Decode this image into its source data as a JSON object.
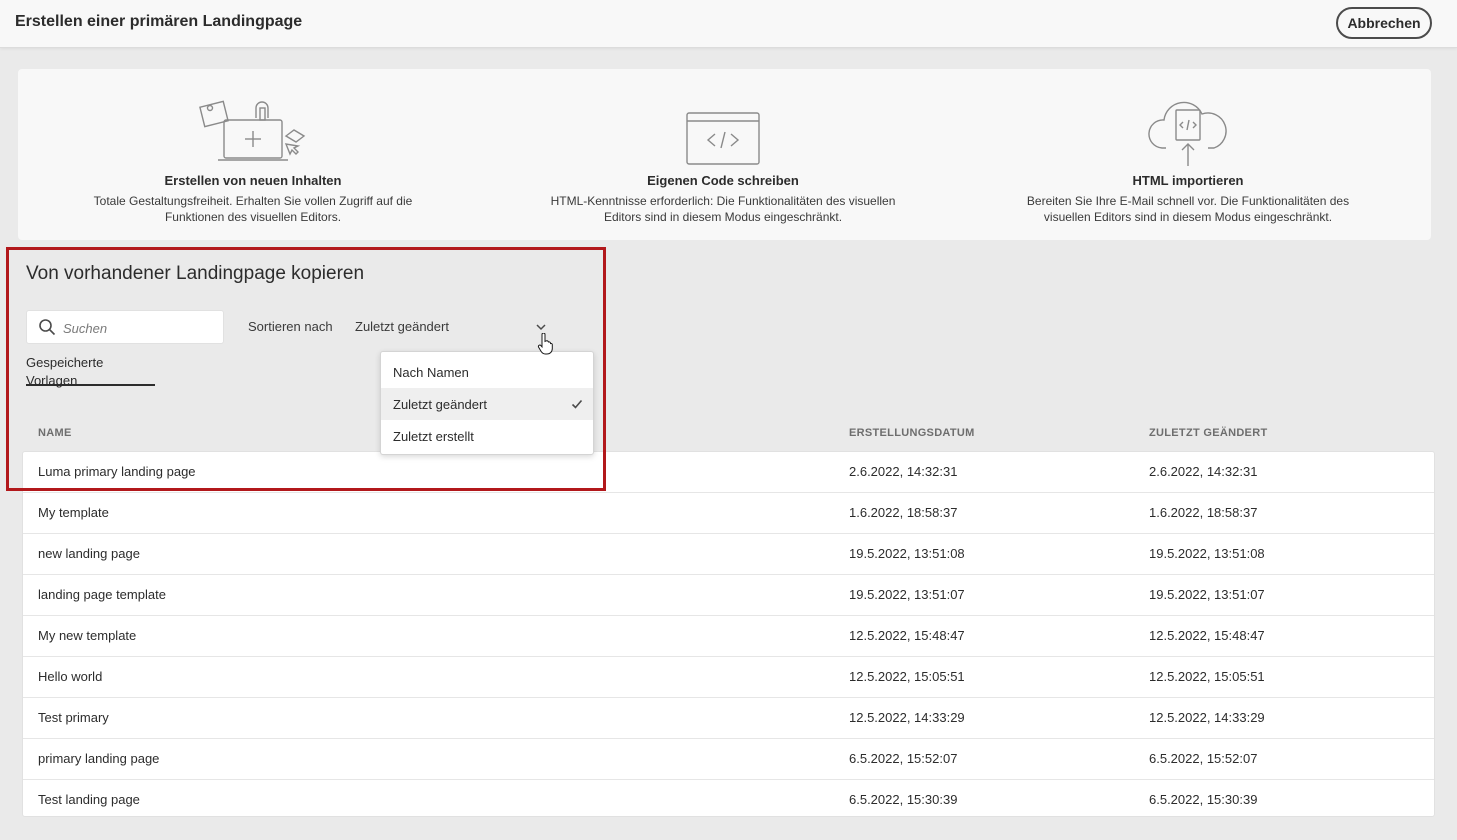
{
  "header": {
    "title": "Erstellen einer primären Landingpage",
    "cancel_label": "Abbrechen"
  },
  "options": [
    {
      "title": "Erstellen von neuen Inhalten",
      "description": "Totale Gestaltungsfreiheit. Erhalten Sie vollen Zugriff auf die Funktionen des visuellen Editors.",
      "icon": "design-canvas-icon"
    },
    {
      "title": "Eigenen Code schreiben",
      "description": "HTML-Kenntnisse erforderlich: Die Funktionalitäten des visuellen Editors sind in diesem Modus eingeschränkt.",
      "icon": "code-window-icon"
    },
    {
      "title": "HTML importieren",
      "description": "Bereiten Sie Ihre E-Mail schnell vor. Die Funktionalitäten des visuellen Editors sind in diesem Modus eingeschränkt.",
      "icon": "cloud-upload-icon"
    }
  ],
  "copy_section": {
    "title": "Von vorhandener Landingpage kopieren",
    "search_placeholder": "Suchen",
    "sort_label": "Sortieren nach",
    "sort_value": "Zuletzt geändert",
    "tab_label": "Gespeicherte Vorlagen"
  },
  "sort_dropdown": {
    "items": [
      {
        "label": "Nach Namen",
        "selected": false
      },
      {
        "label": "Zuletzt geändert",
        "selected": true
      },
      {
        "label": "Zuletzt erstellt",
        "selected": false
      }
    ]
  },
  "table": {
    "columns": [
      "NAME",
      "ERSTELLUNGSDATUM",
      "ZULETZT GEÄNDERT"
    ],
    "rows": [
      {
        "name": "Luma primary landing page",
        "created": "2.6.2022, 14:32:31",
        "modified": "2.6.2022, 14:32:31"
      },
      {
        "name": "My template",
        "created": "1.6.2022, 18:58:37",
        "modified": "1.6.2022, 18:58:37"
      },
      {
        "name": "new  landing page",
        "created": "19.5.2022, 13:51:08",
        "modified": "19.5.2022, 13:51:08"
      },
      {
        "name": "landing page template",
        "created": "19.5.2022, 13:51:07",
        "modified": "19.5.2022, 13:51:07"
      },
      {
        "name": "My new template",
        "created": "12.5.2022, 15:48:47",
        "modified": "12.5.2022, 15:48:47"
      },
      {
        "name": "Hello world",
        "created": "12.5.2022, 15:05:51",
        "modified": "12.5.2022, 15:05:51"
      },
      {
        "name": "Test primary",
        "created": "12.5.2022, 14:33:29",
        "modified": "12.5.2022, 14:33:29"
      },
      {
        "name": "primary landing page",
        "created": "6.5.2022, 15:52:07",
        "modified": "6.5.2022, 15:52:07"
      },
      {
        "name": "Test landing page",
        "created": "6.5.2022, 15:30:39",
        "modified": "6.5.2022, 15:30:39"
      }
    ]
  },
  "colors": {
    "highlight": "#b2181b",
    "background": "#eaeaea",
    "card": "#f8f8f8"
  }
}
